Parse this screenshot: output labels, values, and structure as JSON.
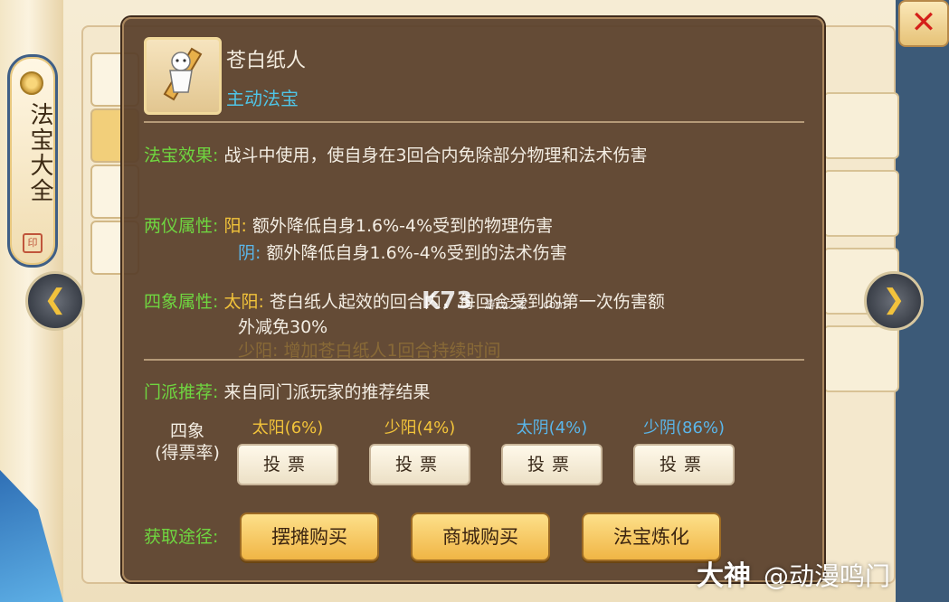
{
  "sidebar": {
    "title": "法宝大全",
    "seal": "印"
  },
  "item": {
    "name": "苍白纸人",
    "type": "主动法宝"
  },
  "effect": {
    "label": "法宝效果:",
    "text": "战斗中使用，使自身在3回合内免除部分物理和法术伤害"
  },
  "liangyi": {
    "label": "两仪属性:",
    "yang_label": "阳:",
    "yang_text": "额外降低自身1.6%-4%受到的物理伤害",
    "yin_label": "阴:",
    "yin_text": "额外降低自身1.6%-4%受到的法术伤害"
  },
  "sixiang": {
    "label": "四象属性:",
    "taiyang_label": "太阳:",
    "taiyang_text_1": "苍白纸人起效的回合内，每回合受到的第一次伤害额",
    "taiyang_text_2": "外减免30%",
    "shaoyang_faded": "少阳: 增加苍白纸人1回合持续时间"
  },
  "recommend": {
    "label": "门派推荐:",
    "text": "来自同门派玩家的推荐结果"
  },
  "vote": {
    "head_1": "四象",
    "head_2": "(得票率)",
    "options": [
      {
        "name": "太阳(6%)",
        "button": "投票"
      },
      {
        "name": "少阳(4%)",
        "button": "投票"
      },
      {
        "name": "太阴(4%)",
        "button": "投票"
      },
      {
        "name": "少阴(86%)",
        "button": "投票"
      }
    ]
  },
  "obtain": {
    "label": "获取途径:",
    "buttons": [
      "摆摊购买",
      "商城购买",
      "法宝炼化"
    ]
  },
  "close_label": "✕",
  "watermark": {
    "brand": "大神",
    "handle": "@动漫鸣门"
  },
  "k73": {
    "brand": "K73",
    "sub": "游戏之家",
    "domain": ".com"
  }
}
